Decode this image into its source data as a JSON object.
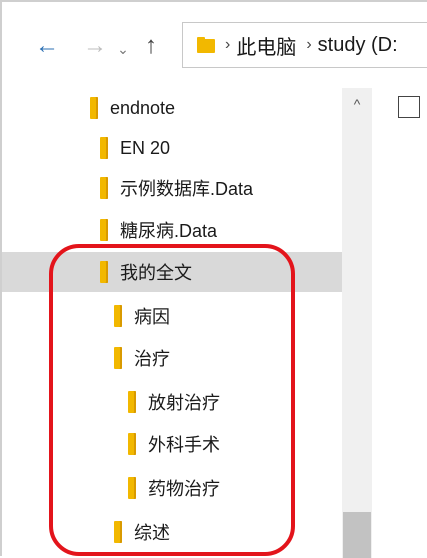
{
  "address_bar": {
    "back_icon": "←",
    "forward_icon": "→",
    "recent_icon": "⌄",
    "up_icon": "↑",
    "separator": "›",
    "crumbs": [
      "此电脑",
      "study (D:"
    ]
  },
  "tree": {
    "items": [
      {
        "label": "endnote",
        "level": 0,
        "selected": false
      },
      {
        "label": "EN 20",
        "level": 1,
        "selected": false
      },
      {
        "label": "示例数据库.Data",
        "level": 1,
        "selected": false
      },
      {
        "label": "糖尿病.Data",
        "level": 1,
        "selected": false
      },
      {
        "label": "我的全文",
        "level": 1,
        "selected": true
      },
      {
        "label": "病因",
        "level": 2,
        "selected": false
      },
      {
        "label": "治疗",
        "level": 2,
        "selected": false
      },
      {
        "label": "放射治疗",
        "level": 3,
        "selected": false
      },
      {
        "label": "外科手术",
        "level": 3,
        "selected": false
      },
      {
        "label": "药物治疗",
        "level": 3,
        "selected": false
      },
      {
        "label": "综述",
        "level": 2,
        "selected": false
      }
    ]
  },
  "scrollbar": {
    "up_icon": "^"
  },
  "colors": {
    "folder": "#f2b800",
    "accent": "#2b6fb3",
    "highlight": "#e3141b",
    "selected": "#d9d9d9"
  }
}
